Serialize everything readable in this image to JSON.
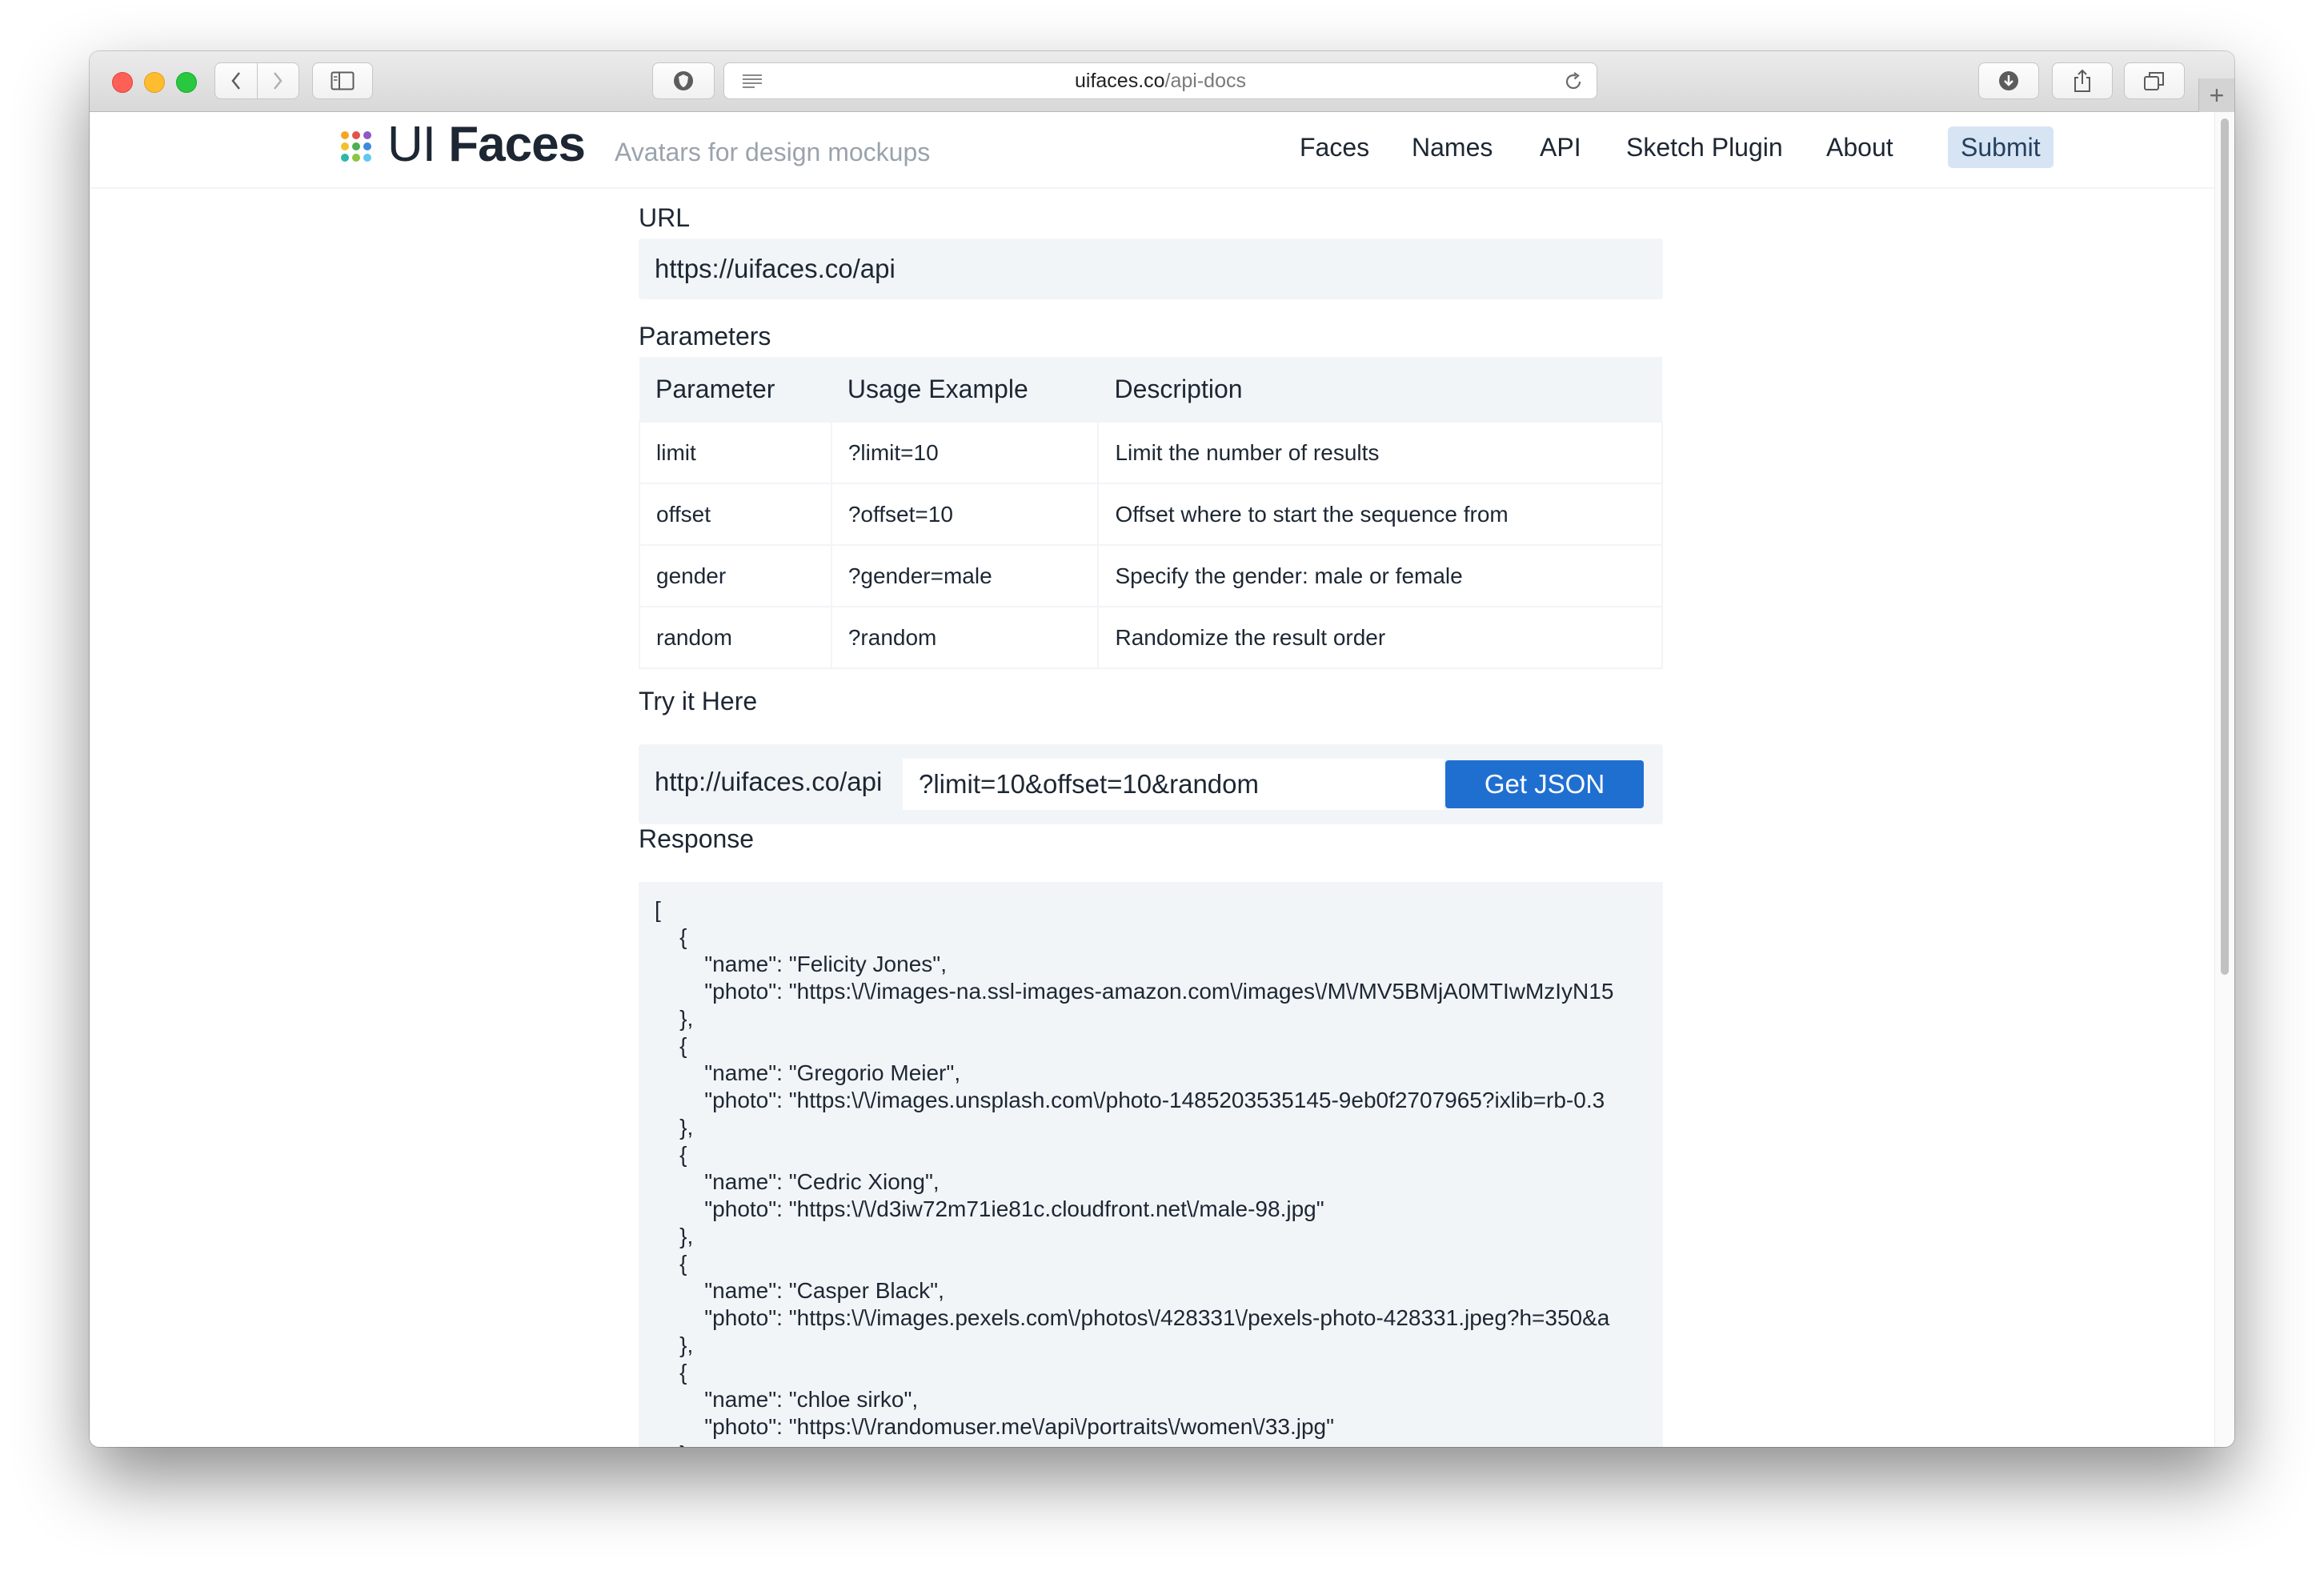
{
  "browser": {
    "url_host": "uifaces.co",
    "url_path": "/api-docs",
    "new_tab_label": "+"
  },
  "header": {
    "brand_prefix": "UI ",
    "brand_bold": "Faces",
    "tagline": "Avatars for design mockups",
    "logo_colors": [
      "#f5a623",
      "#e2534a",
      "#8e58c9",
      "#f2c12e",
      "#4caf50",
      "#3d8be0",
      "#2fb7a8",
      "#8dc63f",
      "#5ec8ef"
    ],
    "nav": [
      {
        "label": "Faces"
      },
      {
        "label": "Names"
      },
      {
        "label": "API"
      },
      {
        "label": "Sketch Plugin"
      },
      {
        "label": "About"
      },
      {
        "label": "Submit"
      }
    ]
  },
  "url_section": {
    "label": "URL",
    "value": "https://uifaces.co/api"
  },
  "params_section": {
    "label": "Parameters",
    "headers": [
      "Parameter",
      "Usage Example",
      "Description"
    ],
    "rows": [
      [
        "limit",
        "?limit=10",
        "Limit the number of results"
      ],
      [
        "offset",
        "?offset=10",
        "Offset where to start the sequence from"
      ],
      [
        "gender",
        "?gender=male",
        "Specify the gender: male or female"
      ],
      [
        "random",
        "?random",
        "Randomize the result order"
      ]
    ]
  },
  "try_section": {
    "label": "Try it Here",
    "prefix": "http://uifaces.co/api",
    "query": "?limit=10&offset=10&random",
    "button": "Get JSON"
  },
  "response_section": {
    "label": "Response",
    "body": "[\n    {\n        \"name\": \"Felicity Jones\",\n        \"photo\": \"https:\\/\\/images-na.ssl-images-amazon.com\\/images\\/M\\/MV5BMjA0MTIwMzIyN15\n    },\n    {\n        \"name\": \"Gregorio Meier\",\n        \"photo\": \"https:\\/\\/images.unsplash.com\\/photo-1485203535145-9eb0f2707965?ixlib=rb-0.3\n    },\n    {\n        \"name\": \"Cedric Xiong\",\n        \"photo\": \"https:\\/\\/d3iw72m71ie81c.cloudfront.net\\/male-98.jpg\"\n    },\n    {\n        \"name\": \"Casper Black\",\n        \"photo\": \"https:\\/\\/images.pexels.com\\/photos\\/428331\\/pexels-photo-428331.jpeg?h=350&a\n    },\n    {\n        \"name\": \"chloe sirko\",\n        \"photo\": \"https:\\/\\/randomuser.me\\/api\\/portraits\\/women\\/33.jpg\"\n    },"
  }
}
